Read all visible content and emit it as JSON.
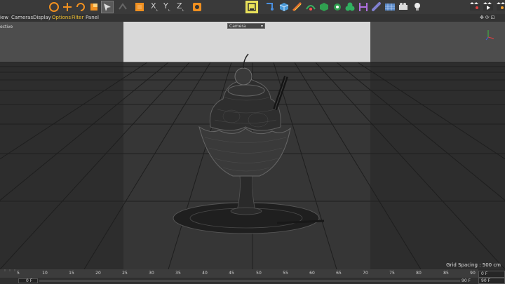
{
  "toolbar": {
    "icons": [
      "undo-icon",
      "move-icon",
      "rotate-icon",
      "scale-icon",
      "select-icon",
      "live-select-icon",
      "object-icon",
      "x-axis-icon",
      "y-axis-icon",
      "z-axis-icon",
      "world-icon",
      "render-icon",
      "cube-icon",
      "pen-icon",
      "spline-icon",
      "generator-icon",
      "mograph-icon",
      "deformer-icon",
      "floor-icon",
      "camera-icon",
      "light-icon"
    ],
    "axis_x": "X",
    "axis_y": "Y",
    "axis_z": "Z"
  },
  "menu": {
    "items": [
      "iew",
      "Cameras",
      "Display",
      "Options",
      "Filter",
      "Panel"
    ],
    "active_color": "#f0c030"
  },
  "viewport": {
    "view_label": "ective",
    "camera": "Camera",
    "grid_spacing": "Grid Spacing : 500 cm"
  },
  "timeline": {
    "ticks": [
      "5",
      "10",
      "15",
      "20",
      "25",
      "30",
      "35",
      "40",
      "45",
      "50",
      "55",
      "60",
      "65",
      "70",
      "75",
      "80",
      "85",
      "90"
    ],
    "start_frame": "0 F",
    "end_frame": "90 F",
    "current_frame": "0 F",
    "max_frame": "90 F"
  },
  "colors": {
    "accent": "#e8e05a",
    "background": "#4d4d4d"
  }
}
